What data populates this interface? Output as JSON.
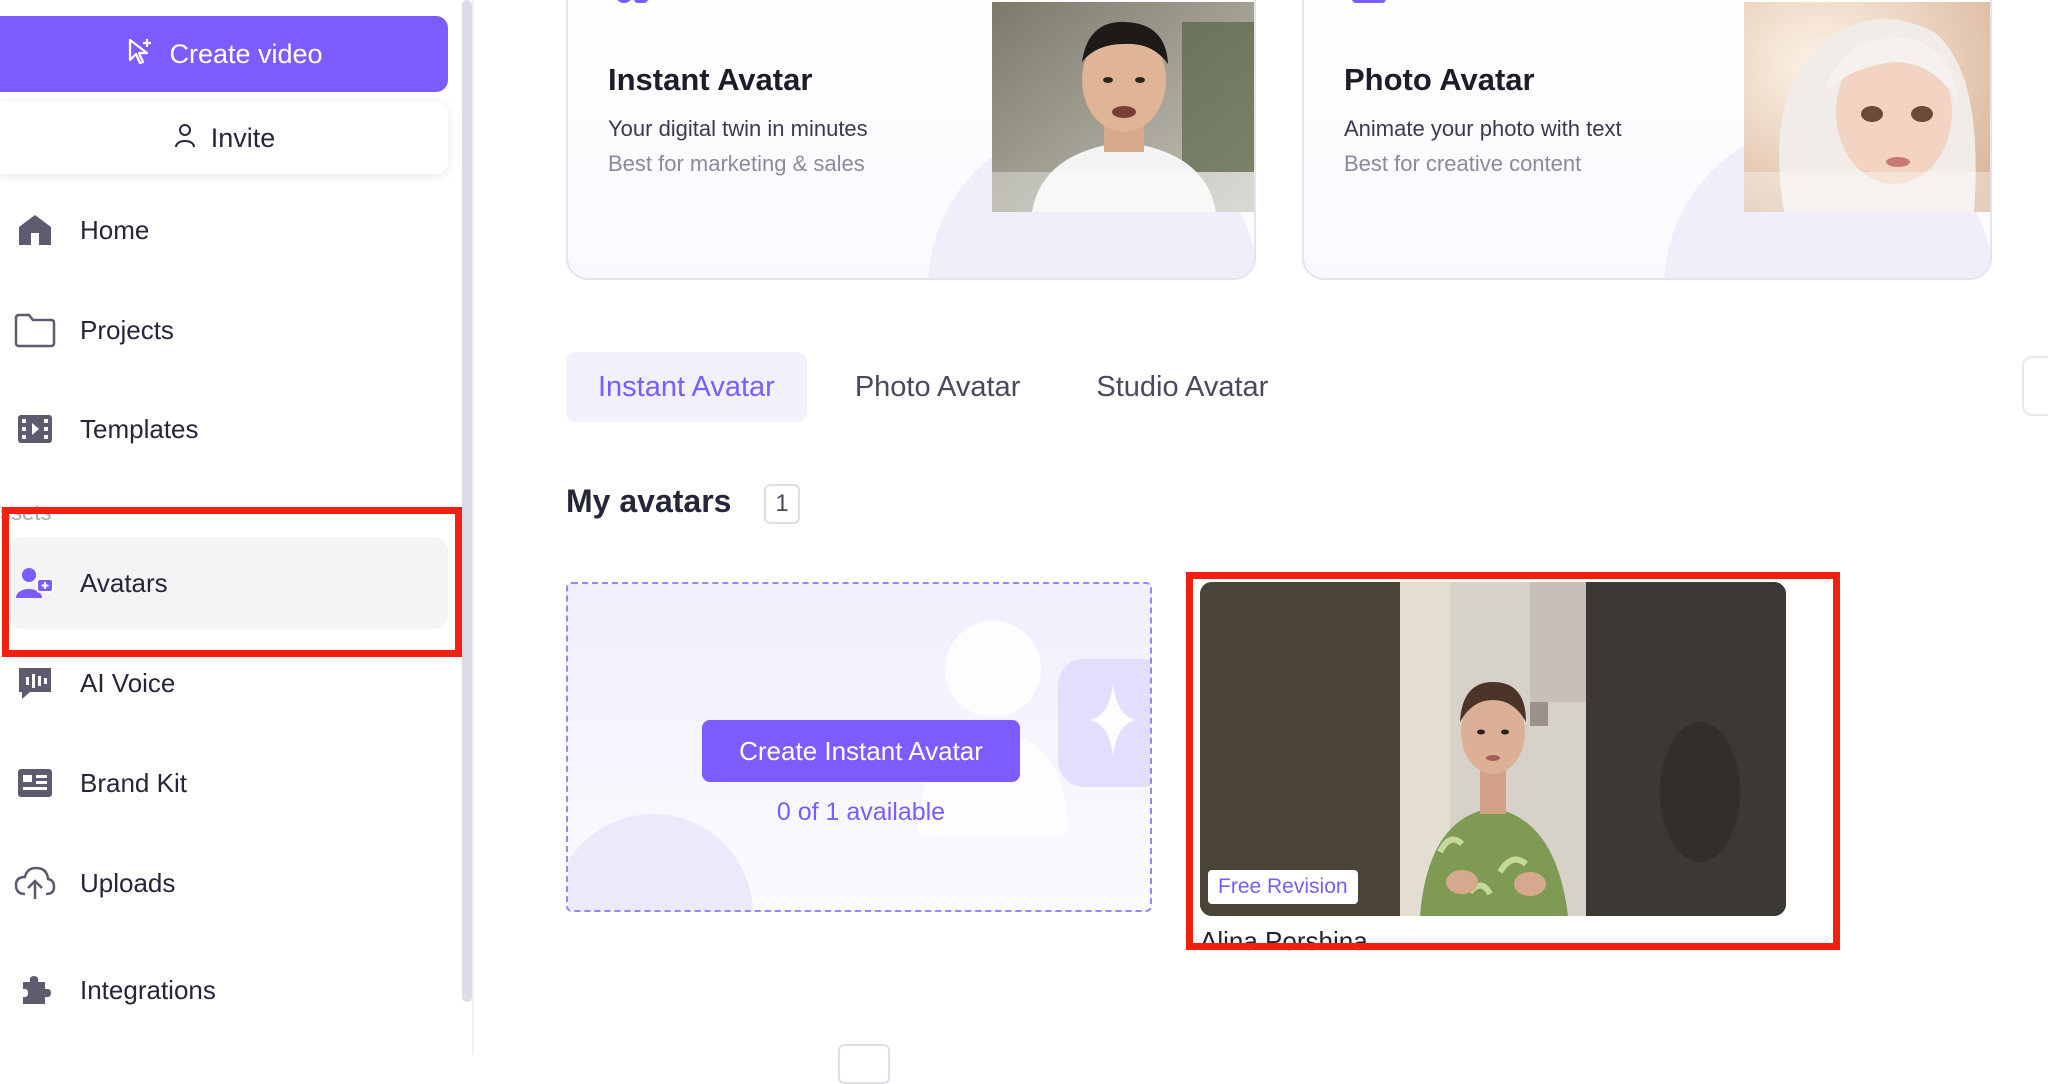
{
  "sidebar": {
    "create_video_label": "Create video",
    "invite_label": "Invite",
    "assets_label": "ssets",
    "items": [
      {
        "label": "Home",
        "icon": "home-icon"
      },
      {
        "label": "Projects",
        "icon": "folder-icon"
      },
      {
        "label": "Templates",
        "icon": "film-icon"
      },
      {
        "label": "Avatars",
        "icon": "avatar-icon",
        "active": true
      },
      {
        "label": "AI Voice",
        "icon": "voice-icon"
      },
      {
        "label": "Brand Kit",
        "icon": "brand-kit-icon"
      },
      {
        "label": "Uploads",
        "icon": "upload-cloud-icon"
      },
      {
        "label": "Integrations",
        "icon": "puzzle-icon"
      }
    ]
  },
  "cards": [
    {
      "title": "Instant Avatar",
      "subtitle": "Your digital twin in minutes",
      "note": "Best for marketing & sales"
    },
    {
      "title": "Photo Avatar",
      "subtitle": "Animate your photo with text",
      "note": "Best for creative content"
    }
  ],
  "tabs": [
    {
      "label": "Instant Avatar",
      "active": true
    },
    {
      "label": "Photo Avatar",
      "active": false
    },
    {
      "label": "Studio Avatar",
      "active": false
    }
  ],
  "my_avatars": {
    "title": "My avatars",
    "count": "1",
    "create_button_label": "Create Instant Avatar",
    "availability": "0 of 1 available",
    "avatar": {
      "badge": "Free Revision",
      "name": "Alina Porshina"
    }
  },
  "colors": {
    "accent": "#7c5cff",
    "highlight": "#f2200f"
  }
}
